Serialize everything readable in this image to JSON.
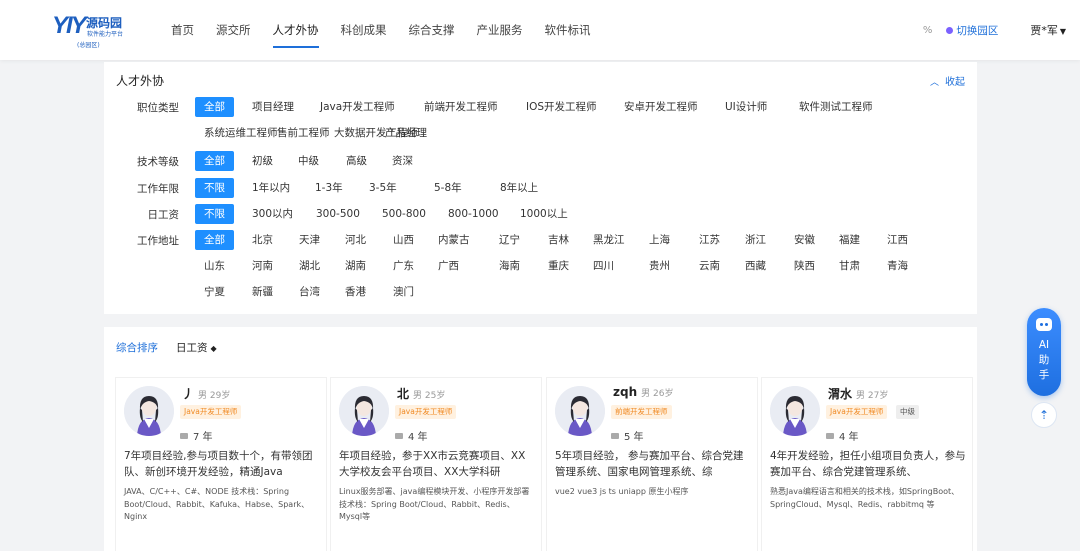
{
  "header": {
    "logo_mark": "YIY",
    "logo_brand": "源码园",
    "logo_sub": "软件能力平台",
    "logo_area": "(总园区)",
    "nav": [
      "首页",
      "源交所",
      "人才外协",
      "科创成果",
      "综合支撑",
      "产业服务",
      "软件标讯"
    ],
    "active_nav": "人才外协",
    "link_icon": "%",
    "switch_label": "切换园区",
    "user": "贾*军"
  },
  "filters": {
    "title": "人才外协",
    "collapse_label": "收起",
    "rows": [
      {
        "label": "职位类型",
        "options": [
          "全部",
          "项目经理",
          "Java开发工程师",
          "前端开发工程师",
          "IOS开发工程师",
          "安卓开发工程师",
          "UI设计师",
          "软件测试工程师",
          "系统运维工程师",
          "售前工程师",
          "大数据开发工程师",
          "产品经理"
        ],
        "selected": "全部"
      },
      {
        "label": "技术等级",
        "options": [
          "全部",
          "初级",
          "中级",
          "高级",
          "资深"
        ],
        "selected": "全部"
      },
      {
        "label": "工作年限",
        "options": [
          "不限",
          "1年以内",
          "1-3年",
          "3-5年",
          "5-8年",
          "8年以上"
        ],
        "selected": "不限"
      },
      {
        "label": "日工资",
        "options": [
          "不限",
          "300以内",
          "300-500",
          "500-800",
          "800-1000",
          "1000以上"
        ],
        "selected": "不限"
      },
      {
        "label": "工作地址",
        "options": [
          "全部",
          "北京",
          "天津",
          "河北",
          "山西",
          "内蒙古",
          "辽宁",
          "吉林",
          "黑龙江",
          "上海",
          "江苏",
          "浙江",
          "安徽",
          "福建",
          "江西",
          "山东",
          "河南",
          "湖北",
          "湖南",
          "广东",
          "广西",
          "海南",
          "重庆",
          "四川",
          "贵州",
          "云南",
          "西藏",
          "陕西",
          "甘肃",
          "青海",
          "宁夏",
          "新疆",
          "台湾",
          "香港",
          "澳门"
        ],
        "selected": "全部"
      }
    ]
  },
  "sort": {
    "comprehensive": "综合排序",
    "daily_wage": "日工资",
    "arrow": "◆"
  },
  "cards": [
    {
      "name": "丿",
      "gender": "男",
      "age": "29岁",
      "tags": [
        {
          "text": "Java开发工程师",
          "style": "orange"
        }
      ],
      "experience": "7 年",
      "desc": "7年项目经验,参与项目数十个，有带领团队、新创环境开发经验，精通Java",
      "skills": "JAVA、C/C++、C#、NODE 技术栈：Spring Boot/Cloud、Rabbit、Kafuka、Habse、Spark、Nginx"
    },
    {
      "name": "北",
      "gender": "男",
      "age": "25岁",
      "tags": [
        {
          "text": "Java开发工程师",
          "style": "orange"
        }
      ],
      "experience": "4 年",
      "desc": "年项目经验，参于XX市云竞赛项目、XX大学校友会平台项目、XX大学科研",
      "skills": "Linux服务部署、java编程模块开发、小程序开发部署 技术栈：Spring Boot/Cloud、Rabbit、Redis、Mysql等"
    },
    {
      "name": "zqh",
      "gender": "男",
      "age": "26岁",
      "tags": [
        {
          "text": "前端开发工程师",
          "style": "orange"
        }
      ],
      "experience": "5 年",
      "desc": "5年项目经验， 参与赛加平台、综合党建管理系统、国家电网管理系统、综",
      "skills": "vue2 vue3 js ts uniapp 原生小程序"
    },
    {
      "name": "渭水",
      "gender": "男",
      "age": "27岁",
      "tags": [
        {
          "text": "Java开发工程师",
          "style": "orange"
        },
        {
          "text": "中级",
          "style": "gray"
        }
      ],
      "experience": "4 年",
      "desc": "4年开发经验，担任小组项目负责人，参与赛加平台、综合党建管理系统、",
      "skills": "熟悉Java编程语言和相关的技术栈，如SpringBoot、SpringCloud、Mysql、Redis、rabbitmq 等"
    }
  ],
  "float": {
    "ai_text": [
      "AI",
      "助",
      "手"
    ],
    "top_icon": "⇡"
  },
  "colors": {
    "accent": "#1e6fd9",
    "chip_selected": "#1e8fff",
    "tag_orange": "#f08a24"
  }
}
